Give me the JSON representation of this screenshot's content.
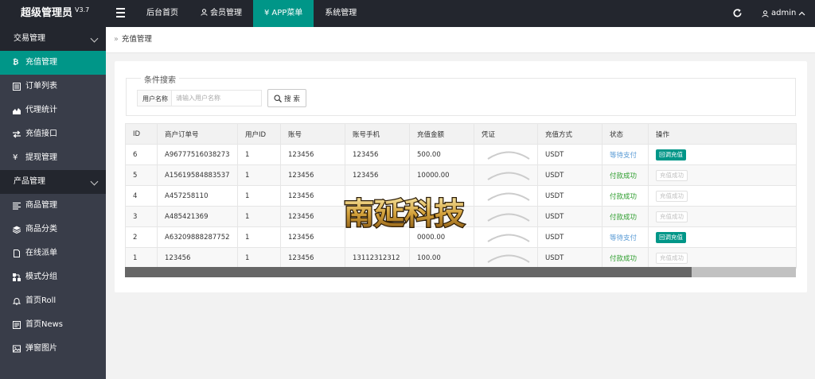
{
  "header": {
    "logo": "超级管理员",
    "version": "V3.7",
    "nav": [
      {
        "label": "后台首页"
      },
      {
        "label": "会员管理"
      },
      {
        "label": "APP菜单"
      },
      {
        "label": "系统管理"
      }
    ],
    "user": "admin"
  },
  "sidebar": {
    "group_trade": "交易管理",
    "trade_items": [
      {
        "label": "充值管理"
      },
      {
        "label": "订单列表"
      },
      {
        "label": "代理统计"
      },
      {
        "label": "充值接口"
      },
      {
        "label": "提现管理"
      }
    ],
    "group_product": "产品管理",
    "product_items": [
      {
        "label": "商品管理"
      },
      {
        "label": "商品分类"
      },
      {
        "label": "在线派单"
      },
      {
        "label": "模式分组"
      },
      {
        "label": "首页Roll"
      },
      {
        "label": "首页News"
      },
      {
        "label": "弹窗图片"
      }
    ]
  },
  "breadcrumb": "充值管理",
  "search": {
    "legend": "条件搜索",
    "label": "用户名称",
    "placeholder": "请输入用户名称",
    "button": "搜 索"
  },
  "table": {
    "columns": [
      "ID",
      "商户订单号",
      "用户ID",
      "账号",
      "账号手机",
      "充值金额",
      "凭证",
      "充值方式",
      "状态",
      "操作"
    ],
    "rows": [
      {
        "id": "6",
        "order": "A96777516038273",
        "uid": "1",
        "account": "123456",
        "phone": "123456",
        "amount": "500.00",
        "method": "USDT",
        "status": "等待支付",
        "action": "回调充值"
      },
      {
        "id": "5",
        "order": "A15619584883537",
        "uid": "1",
        "account": "123456",
        "phone": "123456",
        "amount": "10000.00",
        "method": "USDT",
        "status": "付款成功",
        "action": "充值成功"
      },
      {
        "id": "4",
        "order": "A457258110",
        "uid": "1",
        "account": "123456",
        "phone": "",
        "amount": "",
        "method": "USDT",
        "status": "付款成功",
        "action": "充值成功"
      },
      {
        "id": "3",
        "order": "A485421369",
        "uid": "1",
        "account": "123456",
        "phone": "",
        "amount": "",
        "method": "USDT",
        "status": "付款成功",
        "action": "充值成功"
      },
      {
        "id": "2",
        "order": "A63209888287752",
        "uid": "1",
        "account": "123456",
        "phone": "",
        "amount": "0000.00",
        "method": "USDT",
        "status": "等待支付",
        "action": "回调充值"
      },
      {
        "id": "1",
        "order": "123456",
        "uid": "1",
        "account": "123456",
        "phone": "13112312312",
        "amount": "100.00",
        "method": "USDT",
        "status": "付款成功",
        "action": "充值成功"
      }
    ]
  },
  "watermark": "南延科技",
  "colors": {
    "accent": "#009688",
    "header": "#23262e",
    "sidebar": "#393d49"
  }
}
